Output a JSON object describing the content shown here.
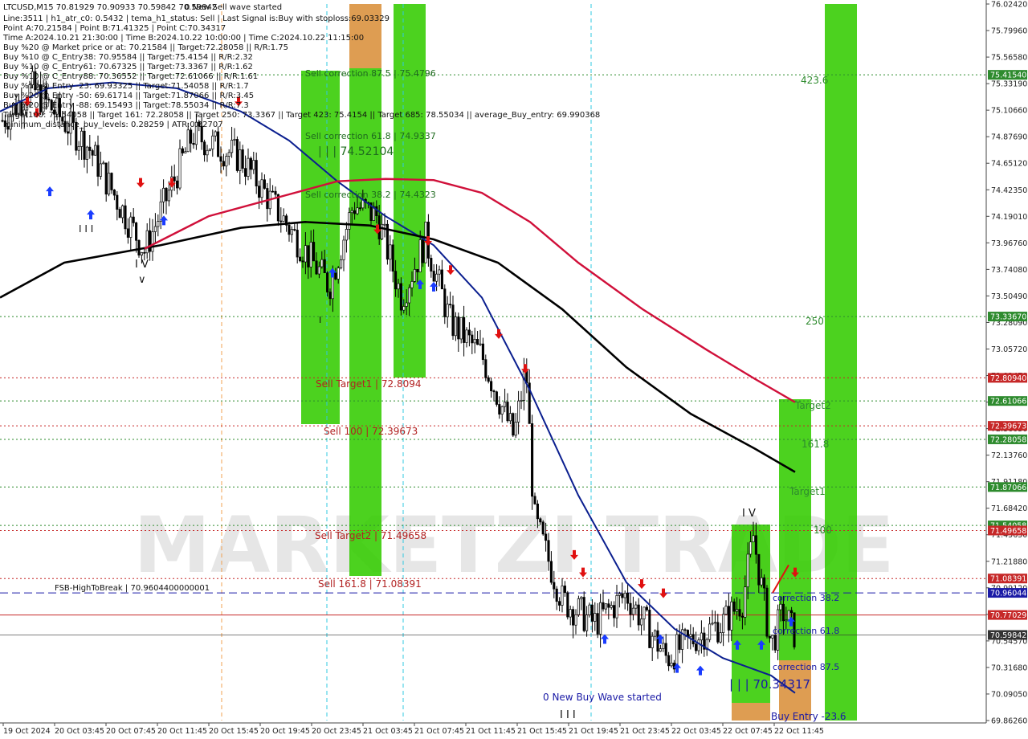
{
  "symbol_header": "LTCUSD,M15  70.81929 70.90933 70.59842 70.59842",
  "info_lines": [
    "Line:3511 | h1_atr_c0: 0.5432 | tema_h1_status: Sell | Last Signal is:Buy with stoploss:69.03329",
    "Point A:70.21584 | Point B:71.41325 | Point C:70.34317",
    "Time A:2024.10.21 21:30:00 | Time B:2024.10.22 10:00:00 | Time C:2024.10.22 11:15:00",
    "Buy %20 @ Market price or at: 70.21584 || Target:72.28058 || R/R:1.75",
    "Buy %10 @ C_Entry38: 70.95584 || Target:75.4154 || R/R:2.32",
    "Buy %10 @ C_Entry61: 70.67325 || Target:73.3367 || R/R:1.62",
    "Buy %10 @ C_Entry88: 70.36552 || Target:72.61066 || R/R:1.61",
    "Buy %10 @ Entry -23: 69.93325 || Target:71.54058 || R/R:1.7",
    "Buy %20 @ Entry -50: 69.61714 || Target:71.87066 || R/R:3.45",
    "Buy %20 @ Entry -88: 69.15493 || Target:78.55034 || R/R:7.3",
    "Target100: 71.54058 || Target 161: 72.28058 || Target 250: 73.3367 || Target 423: 75.4154 || Target 685: 78.55034 || average_Buy_entry: 69.990368",
    "minimum_distance_buy_levels: 0.28259 | ATR:0.32707"
  ],
  "top_label": "0 New Sell wave started",
  "chart_data": {
    "type": "candlestick",
    "symbol": "LTCUSD",
    "timeframe": "M15",
    "ylim": [
      69.8626,
      76.0242
    ],
    "y_ticks": [
      "76.02420",
      "75.79960",
      "75.56580",
      "75.33190",
      "75.10660",
      "74.87690",
      "74.65120",
      "74.42350",
      "74.19010",
      "73.96760",
      "73.74080",
      "73.50490",
      "73.28090",
      "73.05720",
      "72.82470",
      "72.58310",
      "72.36030",
      "72.13760",
      "71.91180",
      "71.68420",
      "71.45650",
      "71.21880",
      "70.99120",
      "70.76290",
      "70.54570",
      "70.31680",
      "70.09050",
      "69.86260"
    ],
    "x_ticks": [
      "19 Oct 2024",
      "20 Oct 03:45",
      "20 Oct 07:45",
      "20 Oct 11:45",
      "20 Oct 15:45",
      "20 Oct 19:45",
      "20 Oct 23:45",
      "21 Oct 03:45",
      "21 Oct 07:45",
      "21 Oct 11:45",
      "21 Oct 15:45",
      "21 Oct 19:45",
      "21 Oct 23:45",
      "22 Oct 03:45",
      "22 Oct 07:45",
      "22 Oct 11:45"
    ],
    "price_tags": [
      {
        "value": 75.4154,
        "label": "75.41540",
        "color": "#2e8b2e"
      },
      {
        "value": 73.3367,
        "label": "73.33670",
        "color": "#2e8b2e"
      },
      {
        "value": 72.8094,
        "label": "72.80940",
        "color": "#c62828"
      },
      {
        "value": 72.61066,
        "label": "72.61066",
        "color": "#2e8b2e"
      },
      {
        "value": 72.39673,
        "label": "72.39673",
        "color": "#c62828"
      },
      {
        "value": 72.28058,
        "label": "72.28058",
        "color": "#2e8b2e"
      },
      {
        "value": 71.87066,
        "label": "71.87066",
        "color": "#2e8b2e"
      },
      {
        "value": 71.54058,
        "label": "71.54058",
        "color": "#2e8b2e"
      },
      {
        "value": 71.49658,
        "label": "71.49658",
        "color": "#c62828"
      },
      {
        "value": 71.08391,
        "label": "71.08391",
        "color": "#c62828"
      },
      {
        "value": 70.96044,
        "label": "70.96044",
        "color": "#1a1aa6"
      },
      {
        "value": 70.77029,
        "label": "70.77029",
        "color": "#c62828"
      },
      {
        "value": 70.59842,
        "label": "70.59842",
        "color": "#333333"
      }
    ],
    "annotations": [
      {
        "text": "Sell correction 87.5 | 75.4796",
        "color": "#1f6b1f"
      },
      {
        "text": "Sell correction 61.8 | 74.9337",
        "color": "#1f6b1f"
      },
      {
        "text": "| | | 74.52104",
        "color": "#1f6b1f"
      },
      {
        "text": "Sell correction 38.2 | 74.4323",
        "color": "#1f6b1f"
      },
      {
        "text": "Sell Target1 | 72.8094",
        "color": "#b22222"
      },
      {
        "text": "Sell 100 | 72.39673",
        "color": "#b22222"
      },
      {
        "text": "Sell Target2 | 71.49658",
        "color": "#b22222"
      },
      {
        "text": "Sell 161.8 | 71.08391",
        "color": "#b22222"
      },
      {
        "text": "FSB-HighToBreak | 70.9604400000001",
        "color": "#111111"
      },
      {
        "text": "0 New Buy Wave started",
        "color": "#1a1aa6"
      },
      {
        "text": "| | | 70.34317",
        "color": "#1a1aa6"
      },
      {
        "text": "423.6",
        "color": "#2e8b2e"
      },
      {
        "text": "250",
        "color": "#2e8b2e"
      },
      {
        "text": "Target2",
        "color": "#2e8b2e"
      },
      {
        "text": "161.8",
        "color": "#2e8b2e"
      },
      {
        "text": "Target1",
        "color": "#2e8b2e"
      },
      {
        "text": "100",
        "color": "#2e8b2e"
      },
      {
        "text": "correction 38.2",
        "color": "#1a1aa6"
      },
      {
        "text": "correction 61.8",
        "color": "#1a1aa6"
      },
      {
        "text": "correction 87.5",
        "color": "#1a1aa6"
      },
      {
        "text": "Buy Entry -23.6",
        "color": "#1a1aa6"
      },
      {
        "text": "I V",
        "color": "#111111"
      },
      {
        "text": "I I I",
        "color": "#111111"
      },
      {
        "text": "I",
        "color": "#111111"
      }
    ],
    "watermark": "MARKETZI TRADE",
    "colors": {
      "up_candle": "#000000",
      "down_candle": "#000000",
      "ma_fast": "#0b1f8f",
      "ma_mid": "#000000",
      "ma_slow": "#d0103a",
      "zone_green": "#33cc00",
      "zone_orange": "#d9903a"
    }
  }
}
